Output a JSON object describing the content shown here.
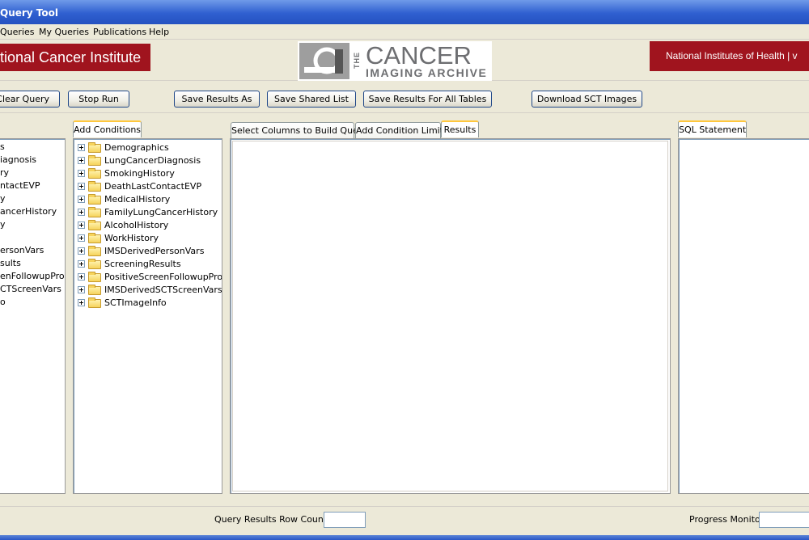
{
  "window": {
    "title": "Query Tool"
  },
  "menu": [
    {
      "label": "Queries"
    },
    {
      "label": "My Queries"
    },
    {
      "label": "Publications"
    },
    {
      "label": "Help"
    }
  ],
  "banner": {
    "left": "National Cancer Institute",
    "center_the": "THE",
    "center_main": "CANCER",
    "center_sub": "IMAGING ARCHIVE",
    "right": "National Institutes of Health | v"
  },
  "toolbar": {
    "clear_query": "Clear Query",
    "stop_run": "Stop Run",
    "save_results_as": "Save Results As",
    "save_shared_list": "Save Shared List",
    "save_results_all": "Save Results For All Tables",
    "download_sct": "Download SCT Images"
  },
  "left_panel": {
    "items": [
      "s",
      "iagnosis",
      "ry",
      "ntactEVP",
      "y",
      "ancerHistory",
      "y",
      "",
      "ersonVars",
      "sults",
      "enFollowupProcs",
      "CTScreenVars",
      "o"
    ]
  },
  "conditions": {
    "tab": "Add Conditions",
    "items": [
      "Demographics",
      "LungCancerDiagnosis",
      "SmokingHistory",
      "DeathLastContactEVP",
      "MedicalHistory",
      "FamilyLungCancerHistory",
      "AlcoholHistory",
      "WorkHistory",
      "IMSDerivedPersonVars",
      "ScreeningResults",
      "PositiveScreenFollowupProcs",
      "IMSDerivedSCTScreenVars",
      "SCTImageInfo"
    ]
  },
  "center_tabs": {
    "select_columns": "Select Columns to Build Query",
    "condition_limits": "Add Condition Limits",
    "results": "Results",
    "active": "Results"
  },
  "sql": {
    "tab": "SQL Statement"
  },
  "status": {
    "row_count_label": "Query Results Row Count",
    "row_count_value": "",
    "progress_label": "Progress Monitor"
  }
}
